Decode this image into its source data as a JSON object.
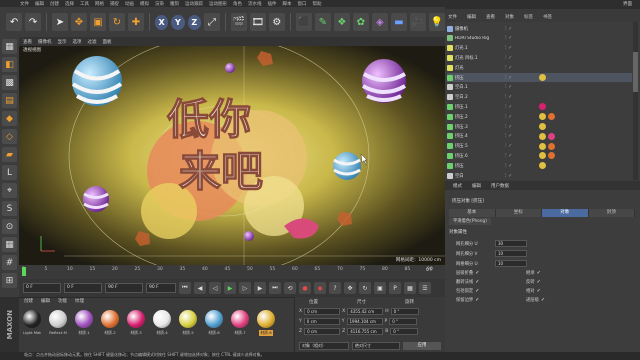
{
  "menubar": {
    "items": [
      "文件",
      "编辑",
      "创建",
      "选择",
      "工具",
      "网格",
      "捕捉",
      "动画",
      "模拟",
      "渲染",
      "雕刻",
      "运动跟踪",
      "运动图形",
      "角色",
      "流水线",
      "插件",
      "脚本",
      "窗口",
      "帮助"
    ]
  },
  "layout": {
    "label": "界面"
  },
  "viewport": {
    "menu": [
      "查看",
      "摄像机",
      "显示",
      "选项",
      "过滤",
      "面板"
    ],
    "name": "透视视图",
    "grid_label": "网格间距：10000 cm",
    "title_text": [
      "低你",
      "来吧"
    ]
  },
  "timeline": {
    "ticks": [
      "0",
      "5",
      "10",
      "15",
      "20",
      "25",
      "30",
      "35",
      "40",
      "45",
      "50",
      "55",
      "60",
      "65",
      "70",
      "75",
      "80",
      "85",
      "90"
    ],
    "frame_readout": "0 F"
  },
  "transport": {
    "start": "0 F",
    "current": "0 F",
    "end": "90 F",
    "end2": "90 F"
  },
  "materials": {
    "menu": [
      "创建",
      "编辑",
      "功能",
      "纹理"
    ],
    "items": [
      {
        "label": "Light Mat",
        "color": "#222"
      },
      {
        "label": "Reflect M",
        "color": "#cfcfcf"
      },
      {
        "label": "材质.1",
        "color": "#a050c0"
      },
      {
        "label": "材质.2",
        "color": "#e07030"
      },
      {
        "label": "材质.3",
        "color": "#d82070"
      },
      {
        "label": "材质.4",
        "color": "#e8e8e8"
      },
      {
        "label": "材质.5",
        "color": "#d8d040"
      },
      {
        "label": "材质.6",
        "color": "#50a0d0"
      },
      {
        "label": "材质.7",
        "color": "#e04080"
      },
      {
        "label": "材质.8",
        "color": "#e0b030"
      }
    ]
  },
  "coords": {
    "heads": [
      "位置",
      "尺寸",
      "旋转"
    ],
    "rows": [
      {
        "axis": "X",
        "pos": "0 cm",
        "size": "4355.42 cm",
        "rotaxis": "H",
        "rot": "0 °"
      },
      {
        "axis": "Y",
        "pos": "0 cm",
        "size": "1994.104 cm",
        "rotaxis": "P",
        "rot": "0 °"
      },
      {
        "axis": "Z",
        "pos": "0 cm",
        "size": "4116.755 cm",
        "rotaxis": "B",
        "rot": "0 °"
      }
    ],
    "mode1": "对象（相对）",
    "mode2": "绝对尺寸",
    "apply": "应用"
  },
  "objects": {
    "menu": [
      "文件",
      "编辑",
      "查看",
      "对象",
      "标签",
      "书签"
    ],
    "rows": [
      {
        "name": "摄像机",
        "color": "#8fb0e0",
        "tags": []
      },
      {
        "name": "HDRI Studio Rig",
        "color": "#7fbf7f",
        "tags": []
      },
      {
        "name": "灯光.1",
        "color": "#e0e060",
        "tags": []
      },
      {
        "name": "灯光 目标.1",
        "color": "#e0e060",
        "tags": []
      },
      {
        "name": "灯光",
        "color": "#e0e060",
        "tags": []
      },
      {
        "name": "挤压",
        "color": "#6cd06c",
        "tags": [
          "#e0c040"
        ]
      },
      {
        "name": "空白.1",
        "color": "#cccccc",
        "tags": []
      },
      {
        "name": "空白.2",
        "color": "#cccccc",
        "tags": []
      },
      {
        "name": "挤压.1",
        "color": "#6cd06c",
        "tags": [
          "#d82070"
        ]
      },
      {
        "name": "挤压.2",
        "color": "#6cd06c",
        "tags": [
          "#e0c040",
          "#e07030"
        ]
      },
      {
        "name": "挤压.3",
        "color": "#6cd06c",
        "tags": [
          "#e0c040"
        ]
      },
      {
        "name": "挤压.4",
        "color": "#6cd06c",
        "tags": [
          "#e0c040",
          "#e04080"
        ]
      },
      {
        "name": "挤压.5",
        "color": "#6cd06c",
        "tags": [
          "#e0c040",
          "#e07030"
        ]
      },
      {
        "name": "挤压.6",
        "color": "#6cd06c",
        "tags": [
          "#e0c040",
          "#e07030"
        ]
      },
      {
        "name": "挤压",
        "color": "#6cd06c",
        "tags": [
          "#e0c040"
        ]
      },
      {
        "name": "空白",
        "color": "#cccccc",
        "tags": []
      }
    ]
  },
  "attributes": {
    "menu": [
      "模式",
      "编辑",
      "用户数据"
    ],
    "object_title": "挤压对象 [挤压]",
    "tabs": [
      "基本",
      "坐标",
      "对象",
      "封顶"
    ],
    "active_tab": "对象",
    "phong": "平滑着色(Phong)",
    "section": "对象属性",
    "params": [
      {
        "label": "网孔细分 U",
        "value": "30"
      },
      {
        "label": "网孔细分 V",
        "value": "10"
      },
      {
        "label": "网格细分 U",
        "value": "10"
      }
    ],
    "checks": [
      "层级折叠",
      "继承",
      "翻转法线",
      "反转",
      "包括锁定",
      "相对",
      "保留边界",
      "递层级"
    ]
  },
  "status": {
    "text": "吸点：点击并拖动鼠标移动元素。按住 SHIFT 键量化移动；节点编辑模式时按住 SHIFT 键增加选择对象；按住 CTRL 键减少选择对象。"
  },
  "maxon": {
    "label": "MAXON"
  }
}
